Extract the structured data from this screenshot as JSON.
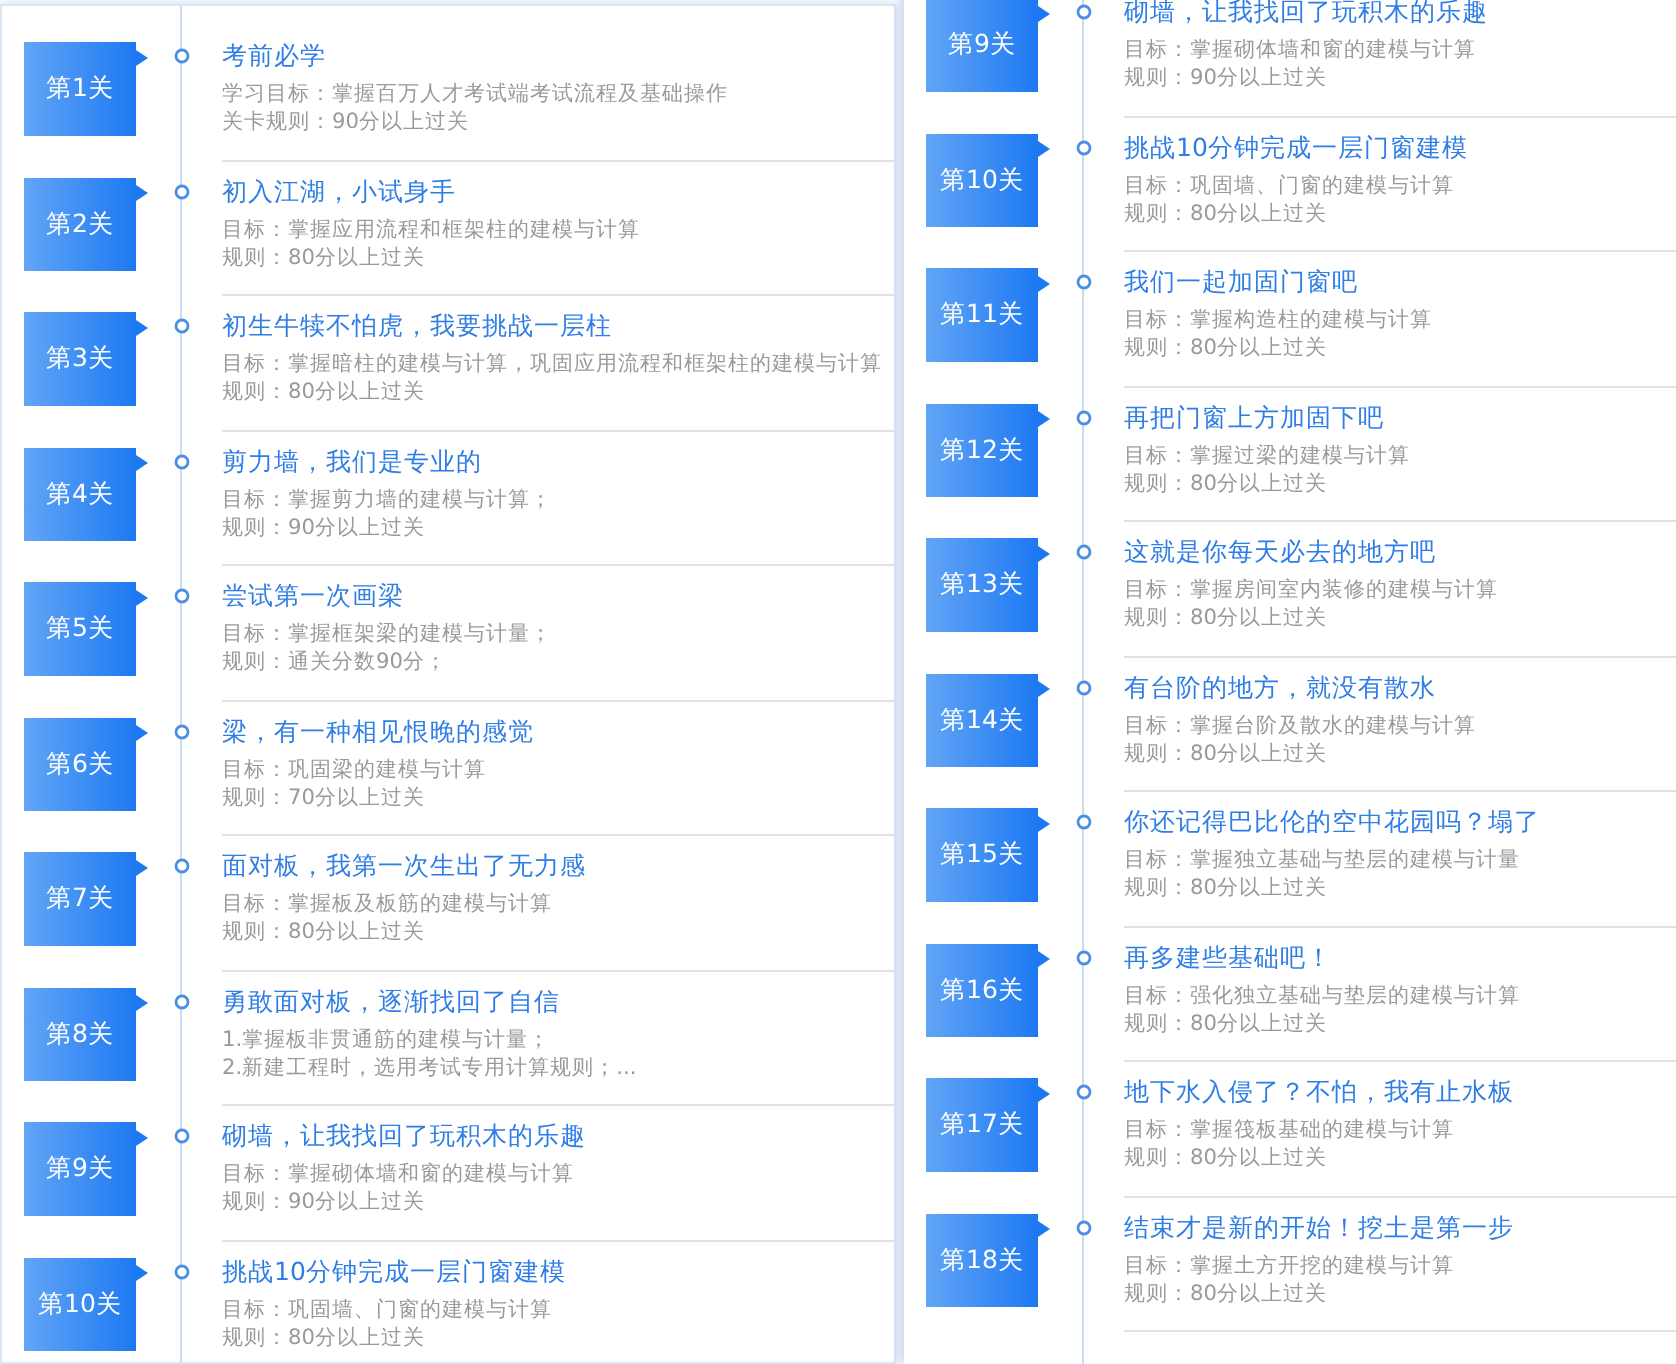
{
  "panels": [
    {
      "levels": [
        {
          "badge": "第1关",
          "title": "考前必学",
          "lines": [
            "学习目标：掌握百万人才考试端考试流程及基础操作",
            "关卡规则：90分以上过关"
          ]
        },
        {
          "badge": "第2关",
          "title": "初入江湖，小试身手",
          "lines": [
            "目标：掌握应用流程和框架柱的建模与计算",
            "规则：80分以上过关"
          ]
        },
        {
          "badge": "第3关",
          "title": "初生牛犊不怕虎，我要挑战一层柱",
          "lines": [
            "目标：掌握暗柱的建模与计算，巩固应用流程和框架柱的建模与计算",
            "规则：80分以上过关"
          ]
        },
        {
          "badge": "第4关",
          "title": "剪力墙，我们是专业的",
          "lines": [
            "目标：掌握剪力墙的建模与计算；",
            "规则：90分以上过关"
          ]
        },
        {
          "badge": "第5关",
          "title": "尝试第一次画梁",
          "lines": [
            "目标：掌握框架梁的建模与计量；",
            "规则：通关分数90分；"
          ]
        },
        {
          "badge": "第6关",
          "title": "梁，有一种相见恨晚的感觉",
          "lines": [
            "目标：巩固梁的建模与计算",
            "规则：70分以上过关"
          ]
        },
        {
          "badge": "第7关",
          "title": "面对板，我第一次生出了无力感",
          "lines": [
            "目标：掌握板及板筋的建模与计算",
            "规则：80分以上过关"
          ]
        },
        {
          "badge": "第8关",
          "title": "勇敢面对板，逐渐找回了自信",
          "lines": [
            "1.掌握板非贯通筋的建模与计量；",
            "2.新建工程时，选用考试专用计算规则；..."
          ]
        },
        {
          "badge": "第9关",
          "title": "砌墙，让我找回了玩积木的乐趣",
          "lines": [
            "目标：掌握砌体墙和窗的建模与计算",
            "规则：90分以上过关"
          ]
        },
        {
          "badge": "第10关",
          "title": "挑战10分钟完成一层门窗建模",
          "lines": [
            "目标：巩固墙、门窗的建模与计算",
            "规则：80分以上过关"
          ]
        }
      ]
    },
    {
      "levels": [
        {
          "badge": "第9关",
          "title": "砌墙，让我找回了玩积木的乐趣",
          "lines": [
            "目标：掌握砌体墙和窗的建模与计算",
            "规则：90分以上过关"
          ]
        },
        {
          "badge": "第10关",
          "title": "挑战10分钟完成一层门窗建模",
          "lines": [
            "目标：巩固墙、门窗的建模与计算",
            "规则：80分以上过关"
          ]
        },
        {
          "badge": "第11关",
          "title": "我们一起加固门窗吧",
          "lines": [
            "目标：掌握构造柱的建模与计算",
            "规则：80分以上过关"
          ]
        },
        {
          "badge": "第12关",
          "title": "再把门窗上方加固下吧",
          "lines": [
            "目标：掌握过梁的建模与计算",
            "规则：80分以上过关"
          ]
        },
        {
          "badge": "第13关",
          "title": "这就是你每天必去的地方吧",
          "lines": [
            "目标：掌握房间室内装修的建模与计算",
            "规则：80分以上过关"
          ]
        },
        {
          "badge": "第14关",
          "title": "有台阶的地方，就没有散水",
          "lines": [
            "目标：掌握台阶及散水的建模与计算",
            "规则：80分以上过关"
          ]
        },
        {
          "badge": "第15关",
          "title": "你还记得巴比伦的空中花园吗？塌了",
          "lines": [
            "目标：掌握独立基础与垫层的建模与计量",
            "规则：80分以上过关"
          ]
        },
        {
          "badge": "第16关",
          "title": "再多建些基础吧！",
          "lines": [
            "目标：强化独立基础与垫层的建模与计算",
            "规则：80分以上过关"
          ]
        },
        {
          "badge": "第17关",
          "title": "地下水入侵了？不怕，我有止水板",
          "lines": [
            "目标：掌握筏板基础的建模与计算",
            "规则：80分以上过关"
          ]
        },
        {
          "badge": "第18关",
          "title": "结束才是新的开始！挖土是第一步",
          "lines": [
            "目标：掌握土方开挖的建模与计算",
            "规则：80分以上过关"
          ]
        }
      ]
    }
  ]
}
